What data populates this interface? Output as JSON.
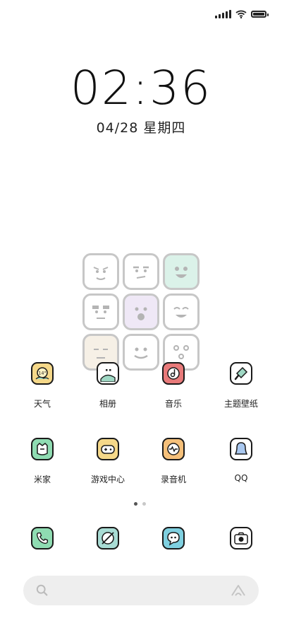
{
  "clock": {
    "time": "02:36",
    "date": "04/28 星期四"
  },
  "apps": [
    {
      "label": "天气",
      "icon": "weather-icon",
      "color": "#f5d889",
      "badge": "14°"
    },
    {
      "label": "相册",
      "icon": "gallery-icon",
      "color": "#9fd8c4"
    },
    {
      "label": "音乐",
      "icon": "music-icon",
      "color": "#e87a7a"
    },
    {
      "label": "主题壁纸",
      "icon": "theme-brush-icon",
      "color": "#9fd8c4"
    },
    {
      "label": "米家",
      "icon": "mijia-icon",
      "color": "#8fdcb2"
    },
    {
      "label": "游戏中心",
      "icon": "gamepad-icon",
      "color": "#f5d889"
    },
    {
      "label": "录音机",
      "icon": "recorder-icon",
      "color": "#f5c07a"
    },
    {
      "label": "QQ",
      "icon": "qq-icon",
      "color": "#a9c8f0"
    }
  ],
  "dock": [
    {
      "icon": "phone-icon",
      "color": "#8fdcb2"
    },
    {
      "icon": "browser-icon",
      "color": "#a8dcd4"
    },
    {
      "icon": "message-icon",
      "color": "#7fd0e0"
    },
    {
      "icon": "camera-icon",
      "color": "#ffffff"
    }
  ],
  "pager": {
    "pages": 2,
    "current": 1
  },
  "colors": {
    "outline": "#1a1a1a",
    "background": "#ffffff",
    "search_bg": "#eeeeee"
  }
}
